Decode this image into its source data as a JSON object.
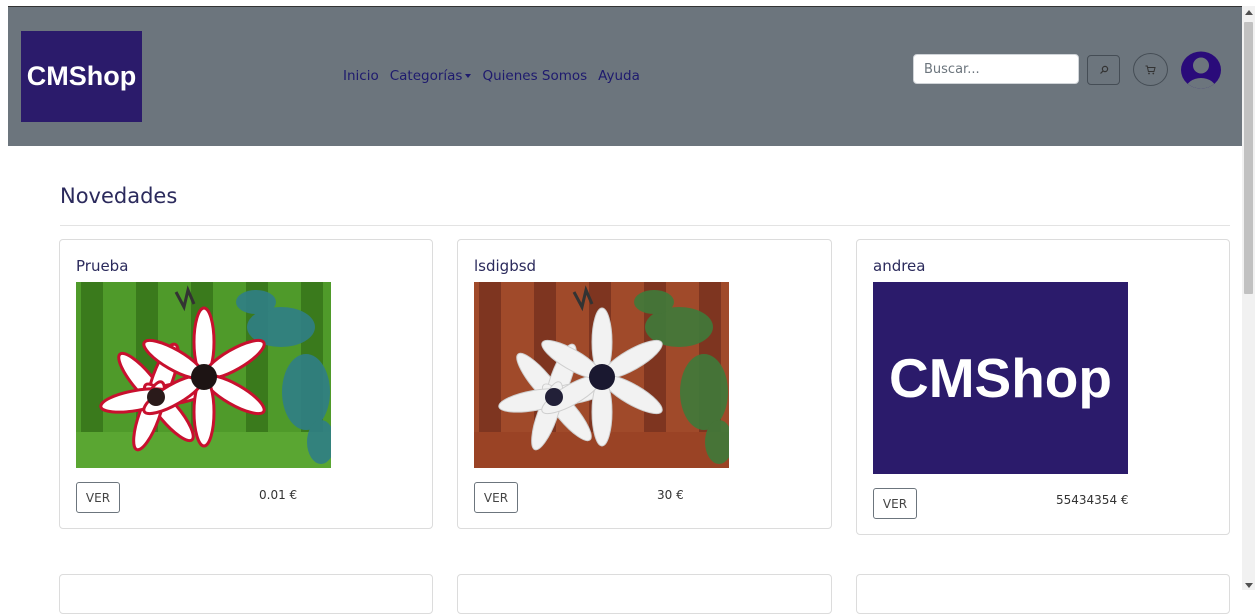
{
  "header": {
    "logo_text": "CMShop",
    "nav": [
      {
        "label": "Inicio"
      },
      {
        "label": "Categorías"
      },
      {
        "label": "Quienes Somos"
      },
      {
        "label": "Ayuda"
      }
    ],
    "search_placeholder": "Buscar...",
    "search_icon": "search-icon",
    "cart_icon": "cart-icon",
    "avatar_icon": "user-avatar-icon"
  },
  "main": {
    "section_title": "Novedades",
    "products": [
      {
        "title": "Prueba",
        "button": "VER",
        "price": "0.01 €",
        "image": "flower-photo-inverted"
      },
      {
        "title": "lsdigbsd",
        "button": "VER",
        "price": "30 €",
        "image": "flower-photo"
      },
      {
        "title": "andrea",
        "button": "VER",
        "price": "55434354 €",
        "image_text": "CMShop"
      }
    ]
  },
  "colors": {
    "navbar": "#6c757d",
    "brand": "#2b1b6b",
    "nav_text": "#1e1a6e"
  }
}
